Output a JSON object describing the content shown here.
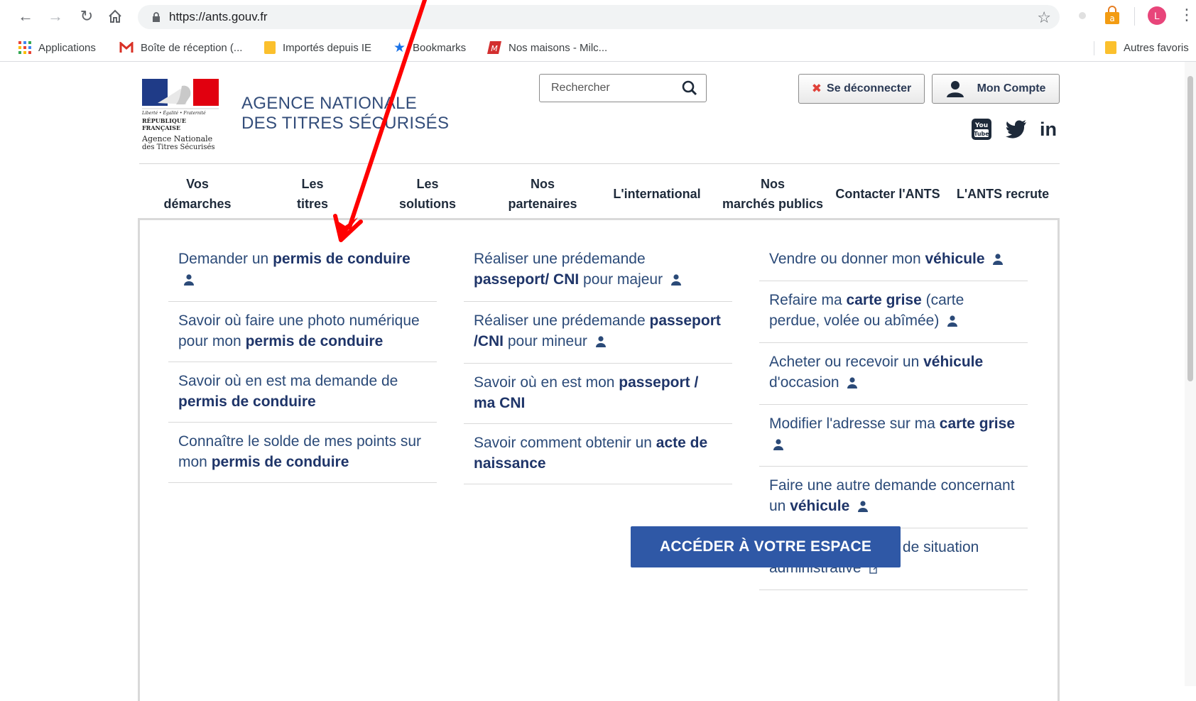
{
  "browser": {
    "url": "https://ants.gouv.fr",
    "profile_initial": "L",
    "bookmarks": [
      {
        "label": "Applications",
        "icon": "apps-grid-icon"
      },
      {
        "label": "Boîte de réception (...",
        "icon": "gmail-icon"
      },
      {
        "label": "Importés depuis IE",
        "icon": "folder-icon"
      },
      {
        "label": "Bookmarks",
        "icon": "star-icon"
      },
      {
        "label": "Nos maisons - Milc...",
        "icon": "site-logo-icon"
      }
    ],
    "other_bookmarks": "Autres favoris"
  },
  "header": {
    "logo_lines": [
      "Liberté • Égalité • Fraternité",
      "RÉPUBLIQUE FRANÇAISE",
      "Agence Nationale",
      "des Titres Sécurisés"
    ],
    "agency_line1": "AGENCE NATIONALE",
    "agency_line2": "DES TITRES SÉCURISÉS",
    "search_placeholder": "Rechercher",
    "logout_label": "Se déconnecter",
    "account_label": "Mon Compte",
    "social": [
      "youtube-icon",
      "twitter-icon",
      "linkedin-icon"
    ]
  },
  "nav": [
    {
      "line1": "Vos",
      "line2": "démarches"
    },
    {
      "line1": "Les",
      "line2": "titres"
    },
    {
      "line1": "Les",
      "line2": "solutions"
    },
    {
      "line1": "Nos",
      "line2": "partenaires"
    },
    {
      "line1": "",
      "line2": "L'international"
    },
    {
      "line1": "Nos",
      "line2": "marchés publics"
    },
    {
      "line1": "",
      "line2": "Contacter l'ANTS"
    },
    {
      "line1": "",
      "line2": "L'ANTS recrute"
    }
  ],
  "columns": {
    "permis": [
      {
        "pre": "Demander un ",
        "bold": "permis de conduire",
        "post": "",
        "icon": "person-icon"
      },
      {
        "pre": "Savoir où faire une photo numérique pour mon ",
        "bold": "permis de conduire",
        "post": "",
        "icon": ""
      },
      {
        "pre": "Savoir où en est ma demande de ",
        "bold": "permis de conduire",
        "post": "",
        "icon": ""
      },
      {
        "pre": "Connaître le solde de mes points sur mon ",
        "bold": "permis de conduire",
        "post": "",
        "icon": ""
      }
    ],
    "passeport": [
      {
        "pre": "Réaliser une prédemande ",
        "bold": "passeport/ CNI",
        "post": " pour majeur",
        "icon": "person-icon"
      },
      {
        "pre": "Réaliser une prédemande ",
        "bold": "passeport /CNI",
        "post": " pour mineur",
        "icon": "person-icon"
      },
      {
        "pre": "Savoir où en est mon ",
        "bold": "passeport / ma CNI",
        "post": "",
        "icon": ""
      },
      {
        "pre": "Savoir comment obtenir un ",
        "bold": "acte de naissance",
        "post": "",
        "icon": ""
      }
    ],
    "vehicule": [
      {
        "pre": "Vendre ou donner mon ",
        "bold": "véhicule",
        "post": "",
        "icon": "person-icon"
      },
      {
        "pre": "Refaire ma ",
        "bold": "carte grise",
        "post": " (carte perdue, volée ou abîmée)",
        "icon": "person-icon"
      },
      {
        "pre": "Acheter ou recevoir un ",
        "bold": "véhicule",
        "post": " d'occasion",
        "icon": "person-icon"
      },
      {
        "pre": "Modifier l'adresse sur ma ",
        "bold": "carte grise",
        "post": "",
        "icon": "person-icon"
      },
      {
        "pre": "Faire une autre demande concernant un ",
        "bold": "véhicule",
        "post": "",
        "icon": "person-icon"
      },
      {
        "pre": "Obtenir un certificat de situation administrative",
        "bold": "",
        "post": "",
        "icon": "external-link-icon"
      }
    ]
  },
  "cta_label": "ACCÉDER À VOTRE ESPACE",
  "colors": {
    "accent_blue": "#2f58a6",
    "link_blue": "#2b4a78",
    "annotation_red": "#ff0000"
  }
}
